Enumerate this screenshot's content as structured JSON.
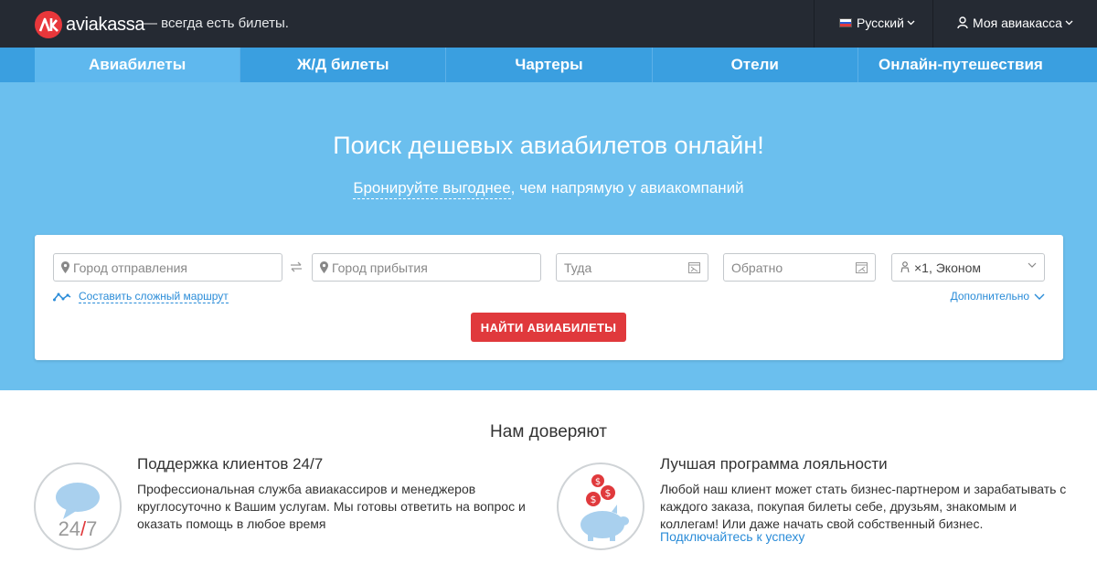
{
  "brand": {
    "name": "aviakassa",
    "slogan": "— всегда есть билеты."
  },
  "header": {
    "language": "Русский",
    "account": "Моя авиакасса"
  },
  "nav": {
    "tabs": [
      "Авиабилеты",
      "Ж/Д билеты",
      "Чартеры",
      "Отели",
      "Онлайн-путешествия"
    ],
    "active": 0
  },
  "hero": {
    "title": "Поиск дешевых авиабилетов онлайн!",
    "subtitle_link": "Бронируйте выгоднее",
    "subtitle_rest": ", чем напрямую у авиакомпаний"
  },
  "search": {
    "from_placeholder": "Город отправления",
    "to_placeholder": "Город прибытия",
    "depart_placeholder": "Туда",
    "return_placeholder": "Обратно",
    "passengers": "×1",
    "cabin": ", Эконом",
    "complex_route": "Составить сложный маршрут",
    "more": "Дополнительно",
    "submit": "НАЙТИ АВИАБИЛЕТЫ"
  },
  "trust": {
    "title": "Нам доверяют",
    "features": [
      {
        "heading": "Поддержка клиентов 24/7",
        "text_lines": [
          "Профессиональная служба авиакассиров и менеджеров",
          "круглосуточно к Вашим услугам. Мы готовы ответить на вопрос и",
          "оказать помощь в любое время"
        ],
        "badge_a": "24",
        "badge_slash": "/",
        "badge_b": "7"
      },
      {
        "heading": "Лучшая программа лояльности",
        "text_lines": [
          "Любой наш клиент может стать бизнес-партнером и зарабатывать с",
          "каждого заказа, покупая билеты себе, друзьям, знакомым и",
          "коллегам! Или даже начать свой собственный бизнес."
        ],
        "link": "Подключайтесь к успеху",
        "coin_symbol": "$"
      }
    ]
  },
  "colors": {
    "topbar": "#252a33",
    "nav": "#3a9fe0",
    "nav_active": "#5fb8ee",
    "hero": "#6bbfee",
    "accent_red": "#e0393c",
    "link": "#2a8cd8"
  }
}
